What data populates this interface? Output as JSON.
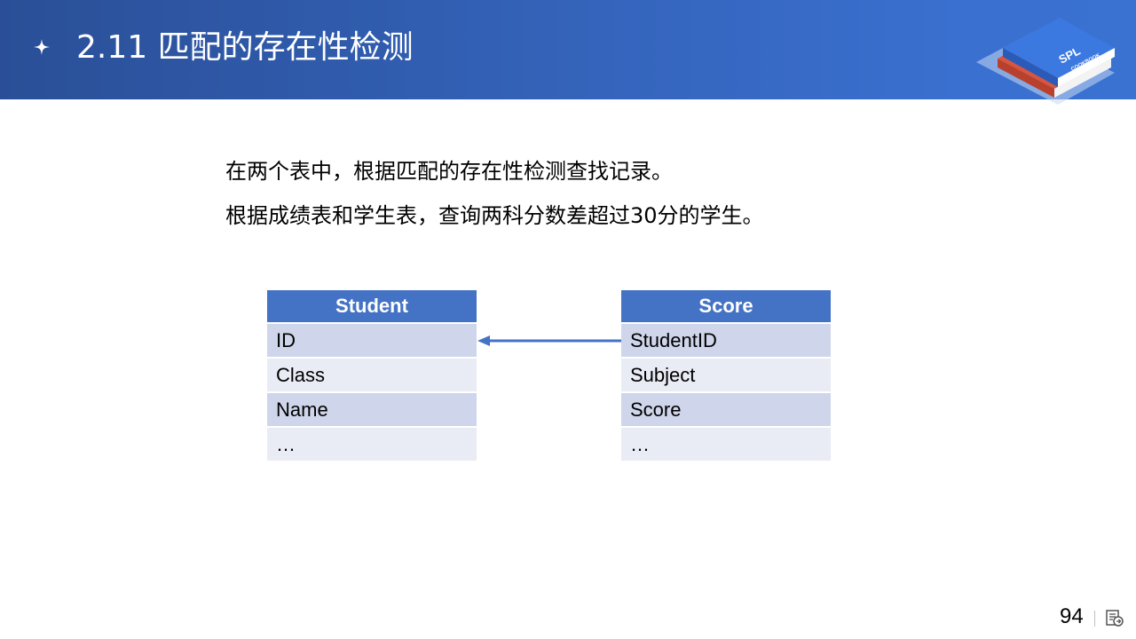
{
  "header": {
    "title": "2.11  匹配的存在性检测",
    "star_icon": "sparkle-icon",
    "logo": {
      "brand": "SPL",
      "sub": "COOKBOOK"
    }
  },
  "description": {
    "line1": "在两个表中，根据匹配的存在性检测查找记录。",
    "line2": "根据成绩表和学生表，查询两科分数差超过30分的学生。"
  },
  "tables": {
    "student": {
      "title": "Student",
      "fields": [
        "ID",
        "Class",
        "Name",
        "…"
      ]
    },
    "score": {
      "title": "Score",
      "fields": [
        "StudentID",
        "Subject",
        "Score",
        "…"
      ]
    }
  },
  "relation": {
    "icon": "arrow-left-icon"
  },
  "footer": {
    "page_number": "94",
    "icon": "document-icon"
  },
  "colors": {
    "header_start": "#2a4f97",
    "header_end": "#3a72d2",
    "table_header": "#4472c4",
    "row_dark": "#cfd5ea",
    "row_light": "#e9ebf5",
    "arrow": "#4472c4"
  }
}
